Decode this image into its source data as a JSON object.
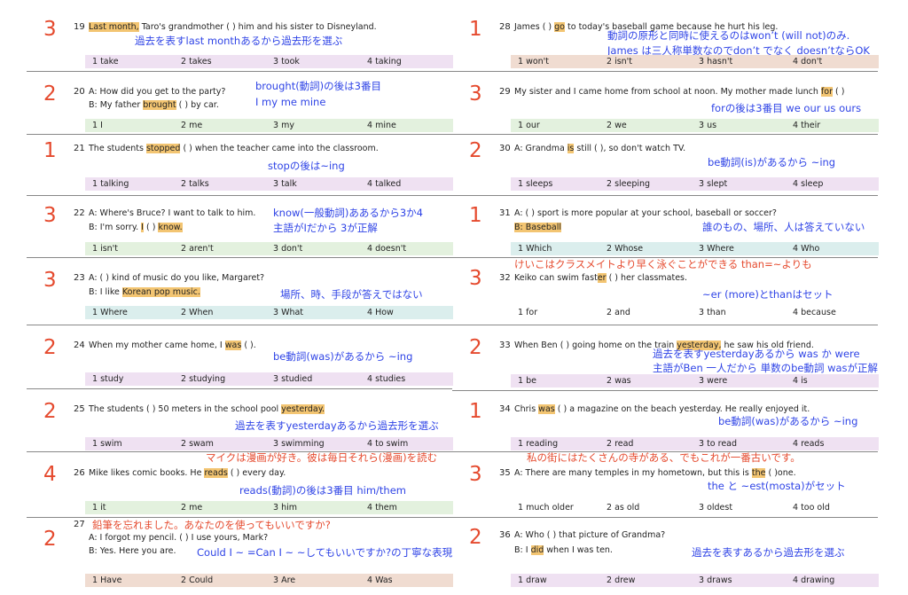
{
  "left": [
    {
      "num": "19",
      "answer": "3",
      "q1": {
        "hl": "Last month,",
        "post": " Taro's grandmother (          ) him and his sister to Disneyland."
      },
      "notes": [
        "過去を表すlast monthあるから過去形を選ぶ"
      ],
      "choices": [
        "1  take",
        "2  takes",
        "3  took",
        "4  taking"
      ]
    },
    {
      "num": "20",
      "answer": "2",
      "q1": {
        "pre": "A: How did you get to the party?"
      },
      "q2": {
        "pre": "B: My father ",
        "hl": "brought",
        "post": " (          ) by car."
      },
      "notes": [
        "brought(動詞)の後は3番目",
        "I my me mine"
      ],
      "choices": [
        "1  I",
        "2  me",
        "3  my",
        "4  mine"
      ]
    },
    {
      "num": "21",
      "answer": "1",
      "q1": {
        "pre": "The students ",
        "hl": "stopped",
        "post": " (          ) when the teacher came into the classroom."
      },
      "notes": [
        "stopの後は~ing"
      ],
      "choices": [
        "1  talking",
        "2  talks",
        "3  talk",
        "4  talked"
      ]
    },
    {
      "num": "22",
      "answer": "3",
      "q1": {
        "pre": "A: Where's Bruce? I want to talk to him."
      },
      "q2": {
        "pre": "B: I'm sorry. ",
        "hl": "I",
        "mid": " (          ) ",
        "hl2": "know."
      },
      "notes": [
        "know(一般動詞)ああるから3か4",
        "主語がIだから 3が正解"
      ],
      "choices": [
        "1  isn't",
        "2  aren't",
        "3  don't",
        "4  doesn't"
      ]
    },
    {
      "num": "23",
      "answer": "3",
      "q1": {
        "pre": "A: (          ) kind of music do you like, Margaret?"
      },
      "q2": {
        "pre": "B: I like ",
        "hl": "Korean pop music."
      },
      "notes": [
        "場所、時、手段が答えではない"
      ],
      "choices": [
        "1  Where",
        "2  When",
        "3  What",
        "4  How"
      ]
    },
    {
      "num": "24",
      "answer": "2",
      "q1": {
        "pre": "When my mother came home, I ",
        "hl": "was",
        "post": " (          )."
      },
      "notes": [
        "be動詞(was)があるから ~ing"
      ],
      "choices": [
        "1  study",
        "2  studying",
        "3  studied",
        "4  studies"
      ]
    },
    {
      "num": "25",
      "answer": "2",
      "q1": {
        "pre": "The students (       ) 50 meters in the school pool ",
        "hl": "yesterday."
      },
      "notes": [
        "過去を表すyesterdayあるから過去形を選ぶ"
      ],
      "choices": [
        "1  swim",
        "2  swam",
        "3  swimming",
        "4  to swim"
      ]
    },
    {
      "num": "26",
      "answer": "4",
      "q1": {
        "pre": "Mike likes comic books. He ",
        "hl": "reads",
        "post": " (          ) every day."
      },
      "redNote": "マイクは漫画が好き。彼は毎日それら(漫画)を読む",
      "notes": [
        "reads(動詞)の後は3番目   him/them"
      ],
      "choices": [
        "1  it",
        "2  me",
        "3  him",
        "4  them"
      ]
    },
    {
      "num": "27",
      "answer": "2",
      "q1": {
        "pre": "A: I forgot my pencil. (          ) I use yours, Mark?"
      },
      "q2": {
        "pre": "B: Yes. Here you are."
      },
      "redNote": "鉛筆を忘れました。あなたのを使ってもいいですか?",
      "notes": [
        "Could I ~ =Can I ~ ~してもいいですか?の丁寧な表現"
      ],
      "choices": [
        "1  Have",
        "2  Could",
        "3  Are",
        "4  Was"
      ]
    }
  ],
  "right": [
    {
      "num": "28",
      "answer": "1",
      "q1": {
        "pre": "James (          ) ",
        "hl": "go",
        "post": " to today's baseball game because he hurt his leg."
      },
      "notes": [
        "動詞の原形と同時に使えるのはwon’t (will not)のみ.",
        "James は三人称単数なのでdon’t でなく doesn’tならOK"
      ],
      "choices": [
        "1  won't",
        "2  isn't",
        "3  hasn't",
        "4  don't"
      ]
    },
    {
      "num": "29",
      "answer": "3",
      "q1": {
        "pre": "My sister and I came home from school at noon. My mother made lunch ",
        "hl": "for",
        "post": " (          )"
      },
      "notes": [
        "forの後は3番目  we our us ours"
      ],
      "choices": [
        "1  our",
        "2  we",
        "3  us",
        "4  their"
      ]
    },
    {
      "num": "30",
      "answer": "2",
      "q1": {
        "pre": "A: Grandma ",
        "hl": "is",
        "post": " still (          ), so don't watch TV."
      },
      "notes": [
        "be動詞(is)があるから ~ing"
      ],
      "choices": [
        "1  sleeps",
        "2  sleeping",
        "3  slept",
        "4  sleep"
      ]
    },
    {
      "num": "31",
      "answer": "1",
      "q1": {
        "pre": "A: (          ) sport is more popular at your school, baseball or soccer?"
      },
      "q2": {
        "hl": "B: Baseball"
      },
      "notes": [
        "誰のもの、場所、人は答えていない"
      ],
      "choices": [
        "1  Which",
        "2  Whose",
        "3  Where",
        "4  Who"
      ]
    },
    {
      "num": "32",
      "answer": "3",
      "q1": {
        "pre": "Keiko can swim fast",
        "hl": "er",
        "post": " (          ) her classmates."
      },
      "redNote": "けいこはクラスメイトより早く泳ぐことができる than=~よりも",
      "notes": [
        "~er (more)とthanはセット"
      ],
      "choices": [
        "1  for",
        "2  and",
        "3  than",
        "4  because"
      ]
    },
    {
      "num": "33",
      "answer": "2",
      "q1": {
        "pre": "When Ben (          ) going home on the train ",
        "hl": "yesterday,",
        "post": " he saw his old friend."
      },
      "notes": [
        "過去を表すyesterdayあるから was か were",
        "主語がBen 一人だから 単数のbe動詞 wasが正解"
      ],
      "choices": [
        "1  be",
        "2  was",
        "3  were",
        "4  is"
      ]
    },
    {
      "num": "34",
      "answer": "1",
      "q1": {
        "pre": "Chris ",
        "hl": "was",
        "post": " (          ) a magazine on the beach yesterday. He really enjoyed it."
      },
      "notes": [
        "be動詞(was)があるから ~ing"
      ],
      "choices": [
        "1  reading",
        "2  read",
        "3  to read",
        "4  reads"
      ]
    },
    {
      "num": "35",
      "answer": "3",
      "q1": {
        "pre": "A: There are many temples in my hometown, but this is ",
        "hl": "the",
        "post": " (          )one."
      },
      "redNote": "私の街にはたくさんの寺がある、でもこれが一番古いです。",
      "notes": [
        "the と ~est(mosta)がセット"
      ],
      "choices": [
        "1  much older",
        "2  as old",
        "3  oldest",
        "4  too old"
      ]
    },
    {
      "num": "36",
      "answer": "2",
      "q1": {
        "pre": "A: Who (          ) that picture of Grandma?"
      },
      "q2": {
        "pre": "B: I ",
        "hl": "did",
        "post": " when I was ten."
      },
      "notes": [
        "過去を表すあるから過去形を選ぶ"
      ],
      "choices": [
        "1  draw",
        "2  drew",
        "3  draws",
        "4  drawing"
      ]
    }
  ]
}
